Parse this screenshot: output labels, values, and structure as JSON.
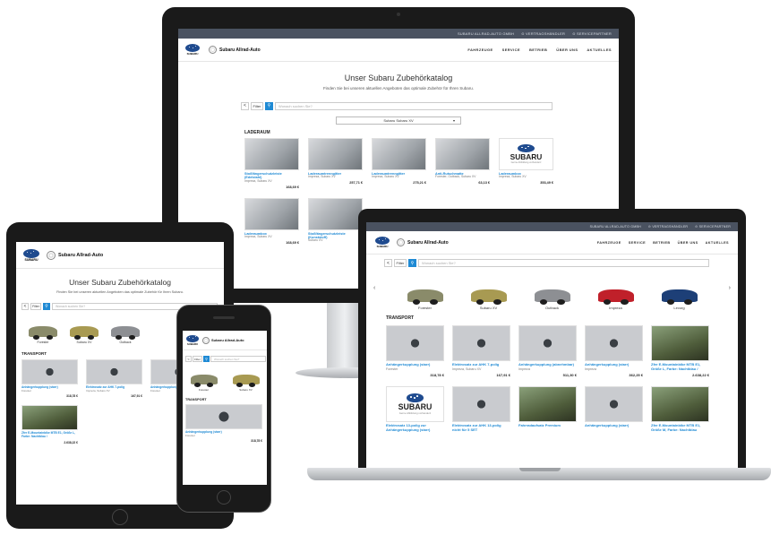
{
  "topbar": {
    "site_label": "SUBARU ALLRAD-AUTO GMBH",
    "dealer_label": "VERTRAGSHÄNDLER",
    "service_label": "SERVICEPARTNER"
  },
  "header": {
    "logo_text": "SUBARU",
    "brand": "Subaru Allrad-Auto",
    "brand_tablet": "Subaru Allrad-Auto",
    "nav": [
      "FAHRZEUGE",
      "SERVICE",
      "BETRIEB",
      "ÜBER UNS",
      "AKTUELLES"
    ]
  },
  "catalog": {
    "title": "Unser Subaru Zubehörkatalog",
    "subtitle": "Finden Sie bei unseren aktuellen Angeboten das optimale Zubehör für Ihren Subaru.",
    "back_label": "<",
    "filter_label": "Filter",
    "search_placeholder": "Wonach suchen Sie?",
    "model_select": "Subaru Subaru XV",
    "section_cargo": "LADERAUM",
    "section_transport": "TRANSPORT"
  },
  "desktop_products": [
    {
      "name": "Stoßfängerschutzleiste (Edelstahl)",
      "sub": "Impreza, Subaru XV",
      "price": "168,69 €",
      "img": "photo"
    },
    {
      "name": "Laderaumtrenngitter",
      "sub": "Impreza, Subaru XV",
      "price": "257,71 €",
      "img": "photo"
    },
    {
      "name": "Laderaumtrenngitter",
      "sub": "Impreza, Subaru XV",
      "price": "275,21 €",
      "img": "photo"
    },
    {
      "name": "Anti-Rutschmatte",
      "sub": "Forester, Outback, Subaru XV",
      "price": "63,13 €",
      "img": "photo"
    },
    {
      "name": "Laderaumbox",
      "sub": "Impreza, Subaru XV",
      "price": "353,49 €",
      "img": "logo"
    },
    {
      "name": "Laderaumbox",
      "sub": "Impreza, Subaru XV",
      "price": "168,69 €",
      "img": "photo"
    },
    {
      "name": "Stoßfängerschutzleiste (Kunststoff)",
      "sub": "Subaru XV",
      "price": "11",
      "img": "photo"
    }
  ],
  "cars": [
    {
      "label": "Forester",
      "color": "#8a8b6a"
    },
    {
      "label": "Subaru XV",
      "color": "#a89a52"
    },
    {
      "label": "Outback",
      "color": "#8d8f93"
    },
    {
      "label": "Impreza",
      "color": "#c0202a"
    },
    {
      "label": "Levorg",
      "color": "#1d3f77"
    }
  ],
  "laptop_products": [
    {
      "name": "Anhängerkupplung (starr)",
      "sub": "Forester",
      "price": "318,78 €",
      "img": "metal"
    },
    {
      "name": "Elektrosatz zur AHK 7-polig",
      "sub": "Impreza, Subaru XV",
      "price": "167,91 €",
      "img": "metal"
    },
    {
      "name": "Anhängerkupplung (abnehmbar)",
      "sub": "Impreza",
      "price": "511,30 €",
      "img": "metal"
    },
    {
      "name": "Anhängerkupplung (starr)",
      "sub": "Impreza",
      "price": "362,25 €",
      "img": "metal"
    },
    {
      "name": "Zfer E-Mountainbike MTB E1, Größe L, Farbe: Nachtblau /",
      "sub": "",
      "price": "2.638,22 €",
      "img": "bike"
    },
    {
      "name": "Elektrosatz 13-polig zur Anhängerkupplung (starr)",
      "sub": "",
      "price": "",
      "img": "logo"
    },
    {
      "name": "Elektrosatz zur AHK 13-polig nicht für 5 SET",
      "sub": "",
      "price": "",
      "img": "metal"
    },
    {
      "name": "Fahrradaufsatz Premium",
      "sub": "",
      "price": "",
      "img": "bike"
    },
    {
      "name": "Anhängerkupplung (starr)",
      "sub": "",
      "price": "",
      "img": "metal"
    },
    {
      "name": "Zfer E-Mountainbike MTB E1, Größe M, Farbe: Nachtblau",
      "sub": "",
      "price": "",
      "img": "bike"
    }
  ],
  "tablet_products": [
    {
      "name": "Anhängerkupplung (starr)",
      "sub": "Forester",
      "price": "318,78 €",
      "img": "metal"
    },
    {
      "name": "Elektrosatz zur AHK 7-polig",
      "sub": "Impreza, Subaru XV",
      "price": "167,91 €",
      "img": "metal"
    },
    {
      "name": "Anhängerkupplung (starr)",
      "sub": "Forester",
      "price": "362,25 €",
      "img": "metal"
    },
    {
      "name": "Zfer E-Mountainbike MTB E1, Größe L, Farbe: Nachtblau /",
      "sub": "",
      "price": "2.638,22 €",
      "img": "bike"
    }
  ],
  "phone_products": [
    {
      "name": "Anhängerkupplung (starr)",
      "sub": "Forester",
      "price": "318,78 €",
      "img": "metal"
    }
  ],
  "logo_placeholder": "Gerne Abbildung vorhanden!",
  "colors": {
    "accent": "#1f8ad4",
    "subaru_blue": "#1f4b8f",
    "topbar": "#4a5260"
  }
}
